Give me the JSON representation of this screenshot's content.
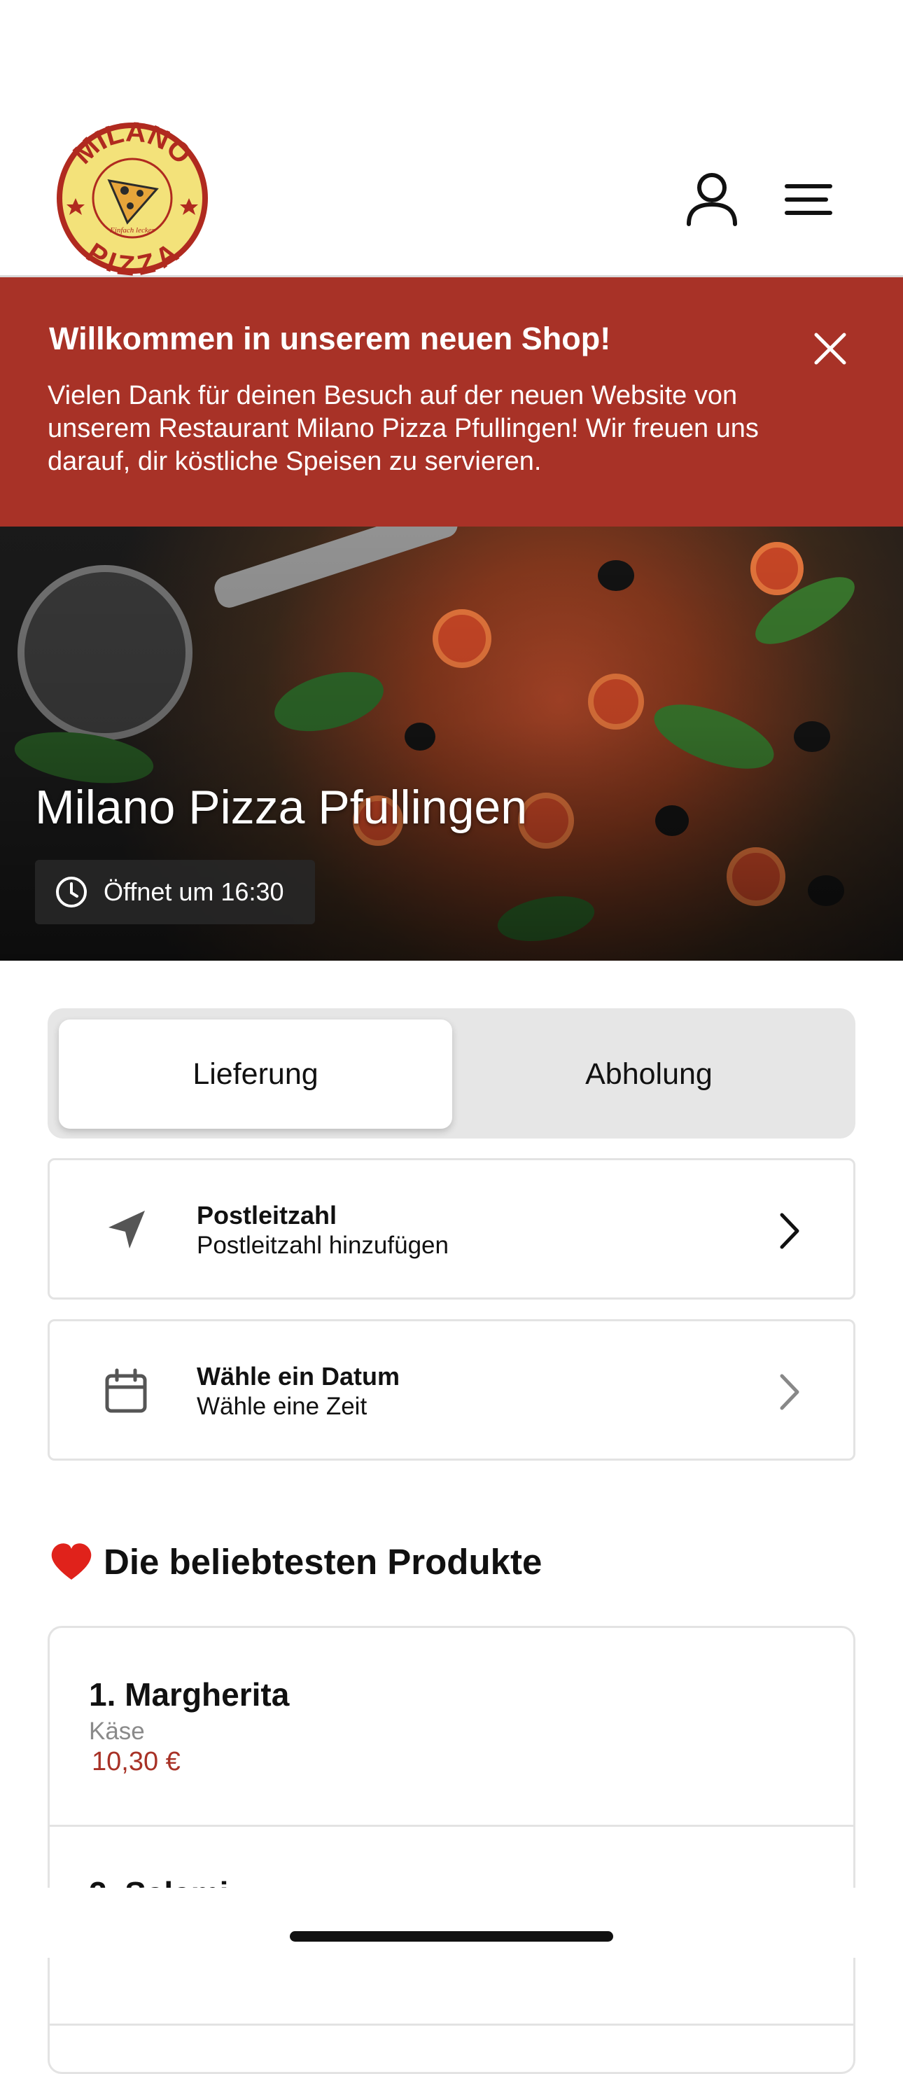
{
  "header": {
    "logo_top_text": "MILANO",
    "logo_bottom_text": "PIZZA",
    "logo_tagline": "Einfach lecker",
    "account_icon": "user-icon",
    "menu_icon": "hamburger-menu-icon"
  },
  "banner": {
    "title": "Willkommen in unserem neuen Shop!",
    "text": "Vielen Dank für deinen Besuch auf der neuen Website von unserem Restaurant Milano Pizza Pfullingen! Wir freuen uns darauf, dir köstliche Speisen zu servieren.",
    "close_icon": "close-icon",
    "background": "#a83227"
  },
  "hero": {
    "title": "Milano Pizza Pfullingen",
    "status": "Öffnet um 16:30",
    "status_icon": "clock-icon"
  },
  "mode_toggle": {
    "options": [
      "Lieferung",
      "Abholung"
    ],
    "selected": "Lieferung"
  },
  "options": {
    "postcode": {
      "title": "Postleitzahl",
      "subtitle": "Postleitzahl hinzufügen",
      "icon": "location-arrow-icon"
    },
    "date": {
      "title": "Wähle ein Datum",
      "subtitle": "Wähle eine Zeit",
      "icon": "calendar-icon"
    }
  },
  "popular": {
    "title": "Die beliebtesten Produkte",
    "icon": "heart-icon",
    "products": [
      {
        "name": "1. Margherita",
        "description": "Käse",
        "price": "10,30 €"
      },
      {
        "name": "2. Salami",
        "description": "",
        "price": ""
      }
    ]
  },
  "colors": {
    "accent": "#a83227",
    "toggle_bg": "#e6e6e6",
    "border": "#e3e3e3"
  }
}
